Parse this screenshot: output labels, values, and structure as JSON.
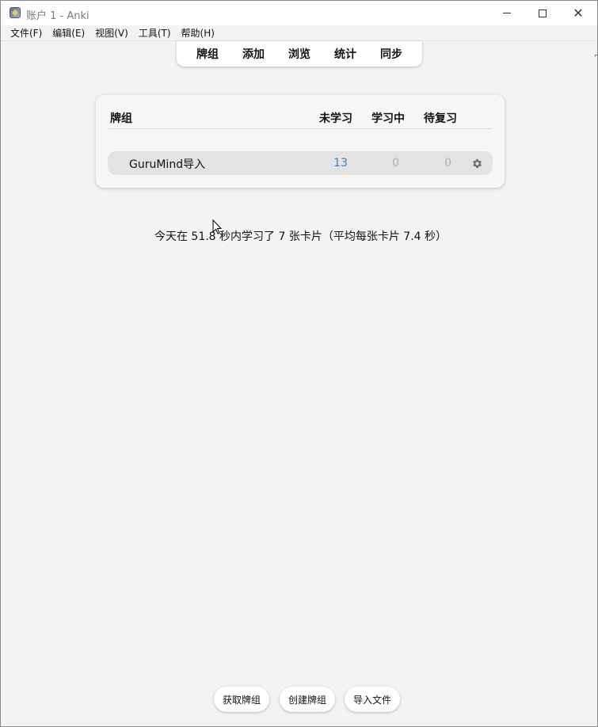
{
  "window": {
    "title": "账户 1 - Anki",
    "icon": "anki-app-icon",
    "controls": {
      "minimize": "minimize-icon",
      "maximize": "maximize-icon",
      "close": "close-icon"
    }
  },
  "menubar": {
    "items": [
      "文件(F)",
      "编辑(E)",
      "视图(V)",
      "工具(T)",
      "帮助(H)"
    ]
  },
  "topnav": {
    "items": [
      "牌组",
      "添加",
      "浏览",
      "统计",
      "同步"
    ]
  },
  "decks": {
    "headers": {
      "deck": "牌组",
      "new": "未学习",
      "learning": "学习中",
      "due": "待复习"
    },
    "rows": [
      {
        "name": "GuruMind导入",
        "new": "13",
        "learning": "0",
        "due": "0",
        "options_icon": "gear-icon"
      }
    ]
  },
  "stats_text": "今天在 51.8 秒内学习了 7 张卡片（平均每张卡片 7.4 秒）",
  "bottom_buttons": {
    "get_shared": "获取牌组",
    "create_deck": "创建牌组",
    "import_file": "导入文件"
  },
  "colors": {
    "new_count": "#3d82c8",
    "zero_count": "#b0b0b0",
    "background": "#f3f3f3"
  }
}
